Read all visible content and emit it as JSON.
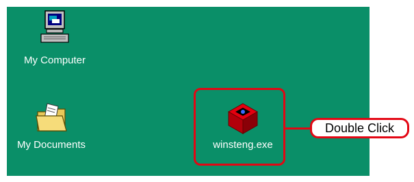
{
  "desktop": {
    "background_color": "#0a8f68",
    "icons": [
      {
        "label": "My Computer",
        "icon": "my-computer-icon"
      },
      {
        "label": "My Documents",
        "icon": "folder-documents-icon"
      },
      {
        "label": "winsteng.exe",
        "icon": "red-box-installer-icon"
      }
    ]
  },
  "annotation": {
    "callout_text": "Double Click",
    "accent_color": "#e30613"
  }
}
